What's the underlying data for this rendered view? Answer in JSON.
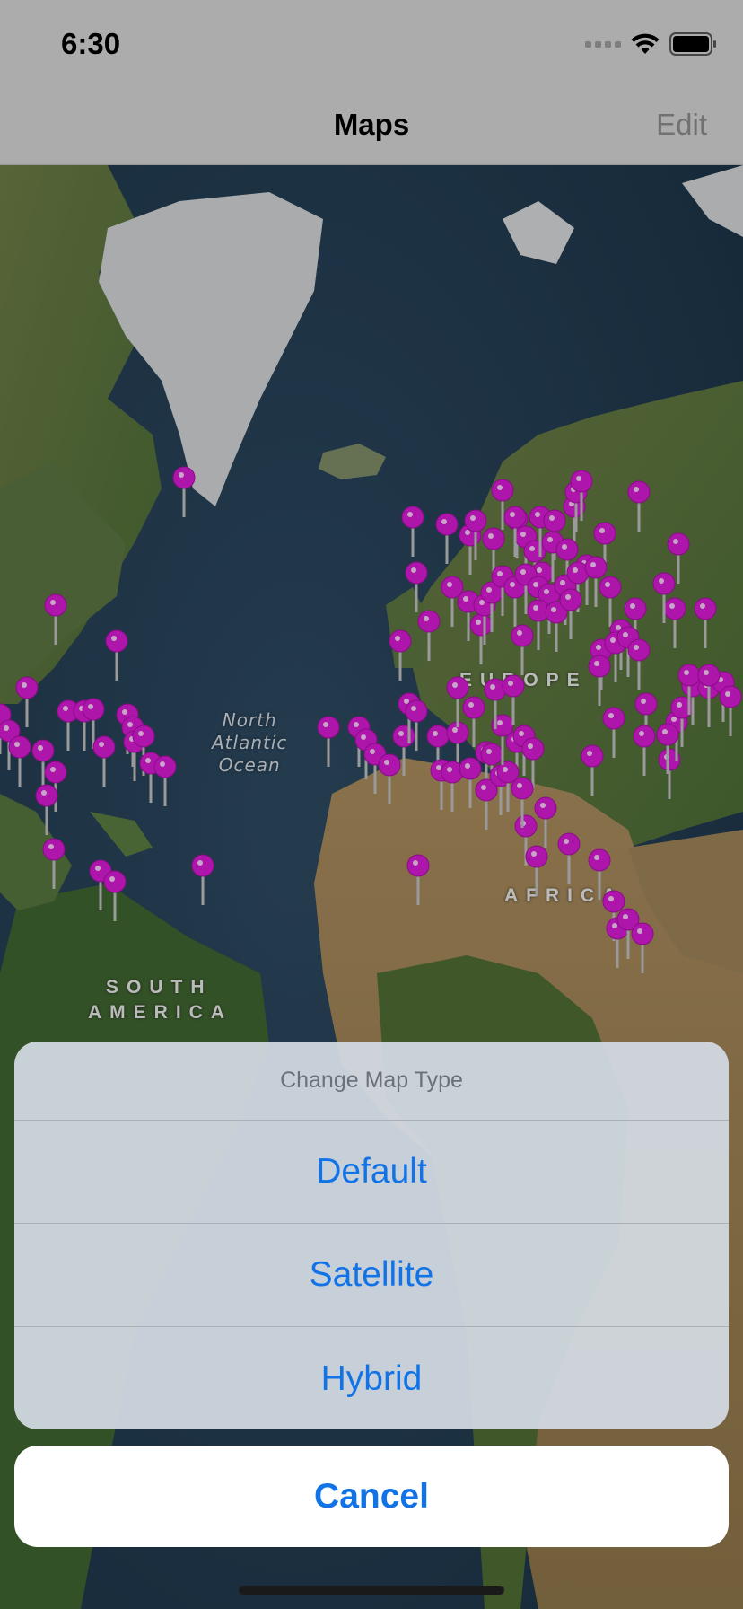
{
  "status_bar": {
    "time": "6:30"
  },
  "nav": {
    "title": "Maps",
    "edit_label": "Edit"
  },
  "map": {
    "ocean_label": "North\nAtlantic\nOcean",
    "labels": {
      "europe": "EUROPE",
      "africa": "AFRICA",
      "south_america_1": "SOUTH",
      "south_america_2": "AMERICA"
    },
    "pin_color": "#d51ad1"
  },
  "action_sheet": {
    "title": "Change Map Type",
    "options": [
      "Default",
      "Satellite",
      "Hybrid"
    ],
    "cancel_label": "Cancel"
  },
  "colors": {
    "accent": "#1173e6"
  }
}
